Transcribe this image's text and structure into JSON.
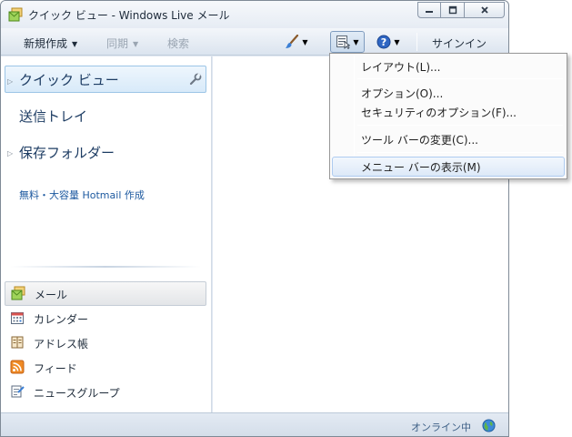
{
  "window": {
    "title": "クイック ビュー - Windows Live メール",
    "caption_buttons": [
      "minimize",
      "maximize",
      "close"
    ]
  },
  "toolbar": {
    "new_label": "新規作成",
    "sync_label": "同期",
    "search_label": "検索",
    "signin_label": "サインイン",
    "icons": [
      "paintbrush-icon",
      "menu-icon",
      "help-icon"
    ]
  },
  "folders": {
    "items": [
      {
        "label": "クイック ビュー",
        "expandable": true,
        "selected": true
      },
      {
        "label": "送信トレイ",
        "expandable": false,
        "selected": false
      },
      {
        "label": "保存フォルダー",
        "expandable": true,
        "selected": false
      }
    ],
    "hotmail_link": "無料・大容量 Hotmail 作成"
  },
  "nav": {
    "items": [
      {
        "label": "メール",
        "icon": "mail-icon",
        "selected": true
      },
      {
        "label": "カレンダー",
        "icon": "calendar-icon",
        "selected": false
      },
      {
        "label": "アドレス帳",
        "icon": "address-book-icon",
        "selected": false
      },
      {
        "label": "フィード",
        "icon": "feed-icon",
        "selected": false
      },
      {
        "label": "ニュースグループ",
        "icon": "newsgroup-icon",
        "selected": false
      }
    ]
  },
  "menu": {
    "items": [
      {
        "label": "レイアウト(L)..."
      },
      {
        "label": "オプション(O)..."
      },
      {
        "label": "セキュリティのオプション(F)..."
      },
      {
        "label": "ツール バーの変更(C)..."
      },
      {
        "label": "メニュー バーの表示(M)",
        "highlighted": true
      }
    ]
  },
  "status": {
    "text": "オンライン中"
  },
  "colors": {
    "accent": "#1e5aa0",
    "selection": "#d8eaf9",
    "toolbar_text": "#1e2b3a",
    "disabled_text": "#9aa5b2"
  }
}
